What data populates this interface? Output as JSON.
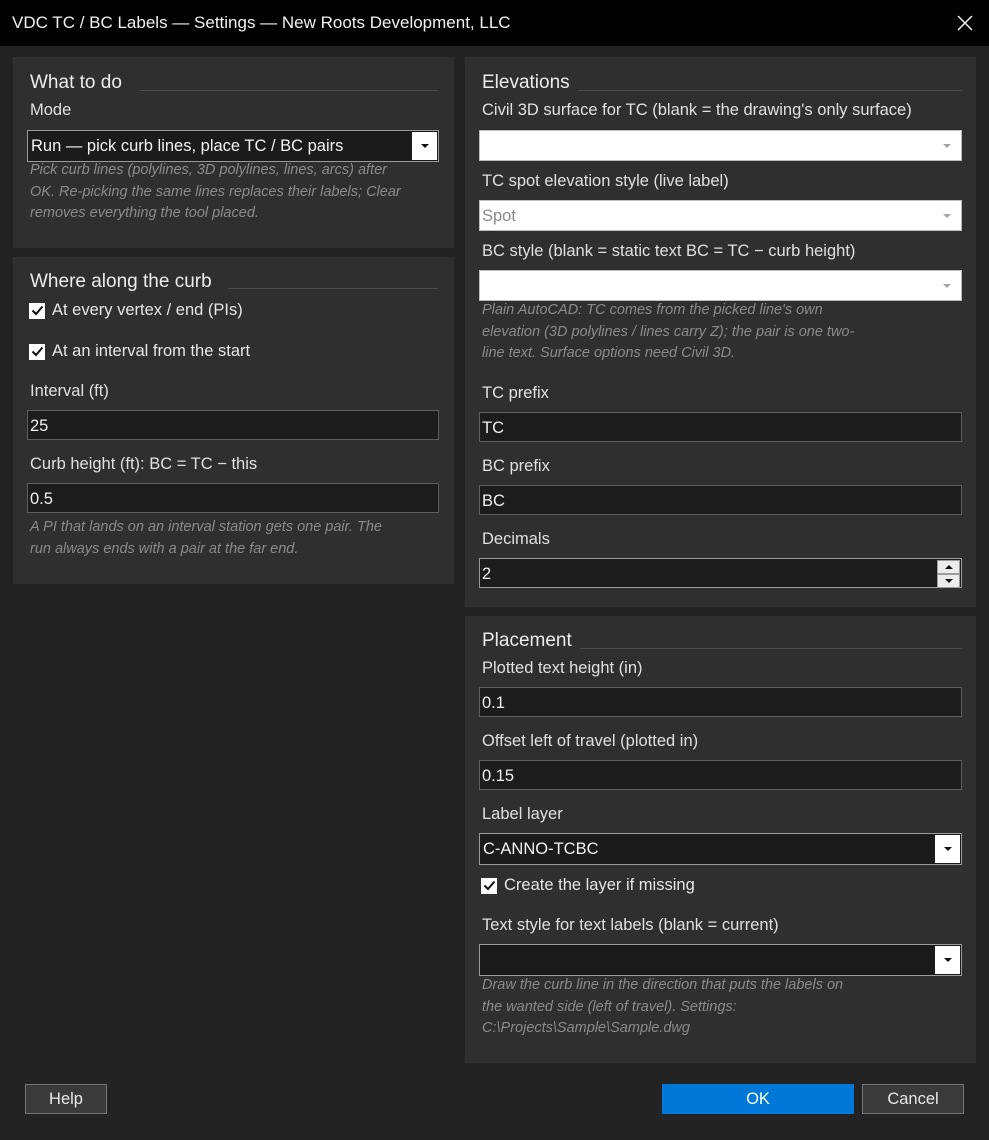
{
  "window": {
    "title": "VDC TC / BC Labels — Settings — New Roots Development, LLC"
  },
  "what_to_do": {
    "title": "What to do",
    "mode_label": "Mode",
    "mode_value": "Run — pick curb lines, place TC / BC pairs",
    "hint_lines": [
      "Pick curb lines (polylines, 3D polylines, lines, arcs) after",
      "OK. Re-picking the same lines replaces their labels; Clear",
      "removes everything the tool placed."
    ]
  },
  "where": {
    "title": "Where along the curb",
    "check_vertex": {
      "label": "At every vertex / end (PIs)",
      "checked": true
    },
    "check_interval": {
      "label": "At an interval from the start",
      "checked": true
    },
    "interval_label": "Interval (ft)",
    "interval_value": "25",
    "curb_height_label": "Curb height (ft): BC = TC − this",
    "curb_height_value": "0.5",
    "hint_lines": [
      "A PI that lands on an interval station gets one pair. The",
      "run always ends with a pair at the far end."
    ]
  },
  "elevations": {
    "title": "Elevations",
    "surface_label": "Civil 3D surface for TC (blank = the drawing's only surface)",
    "surface_value": "",
    "tc_style_label": "TC spot elevation style (live label)",
    "tc_style_value": "Spot",
    "bc_style_label": "BC style (blank = static text BC = TC − curb height)",
    "bc_style_value": "",
    "hint_lines": [
      "Plain AutoCAD: TC comes from the picked line's own",
      "elevation (3D polylines / lines carry Z); the pair is one two-",
      "line text. Surface options need Civil 3D."
    ],
    "tc_prefix_label": "TC prefix",
    "tc_prefix_value": "TC",
    "bc_prefix_label": "BC prefix",
    "bc_prefix_value": "BC",
    "decimals_label": "Decimals",
    "decimals_value": "2"
  },
  "placement": {
    "title": "Placement",
    "text_height_label": "Plotted text height (in)",
    "text_height_value": "0.1",
    "offset_label": "Offset left of travel (plotted in)",
    "offset_value": "0.15",
    "layer_label": "Label layer",
    "layer_value": "C-ANNO-TCBC",
    "create_layer": {
      "label": "Create the layer if missing",
      "checked": true
    },
    "text_style_label": "Text style for text labels (blank = current)",
    "text_style_value": "",
    "hint_lines": [
      "Draw the curb line in the direction that puts the labels on",
      "the wanted side (left of travel). Settings:",
      "C:\\Projects\\Sample\\Sample.dwg"
    ]
  },
  "buttons": {
    "help": "Help",
    "ok": "OK",
    "cancel": "Cancel"
  },
  "colors": {
    "background": "#232323",
    "panel": "#2f2f30",
    "title_bar": "#000000",
    "accent": "#0078d7"
  }
}
